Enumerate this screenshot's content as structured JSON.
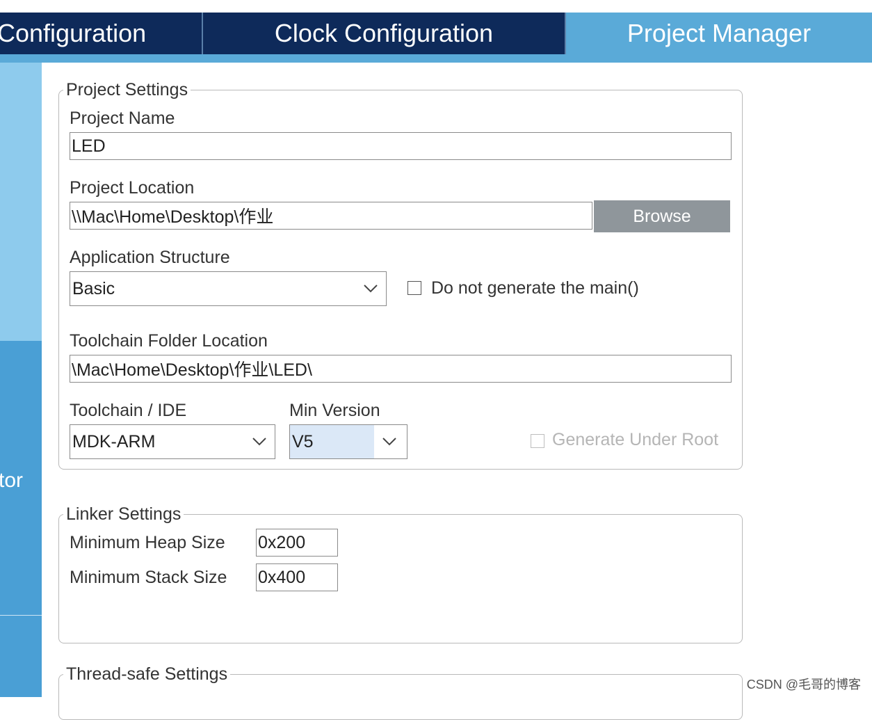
{
  "tabs": {
    "pinout": "Configuration",
    "clock": "Clock Configuration",
    "project_manager": "Project Manager"
  },
  "sidebar": {
    "partial_label": "tor"
  },
  "project_settings": {
    "legend": "Project Settings",
    "project_name_label": "Project Name",
    "project_name_value": "LED",
    "project_location_label": "Project Location",
    "project_location_value": "\\\\Mac\\Home\\Desktop\\作业",
    "browse_label": "Browse",
    "app_structure_label": "Application Structure",
    "app_structure_value": "Basic",
    "no_main_label": "Do not generate the main()",
    "toolchain_folder_label": "Toolchain Folder Location",
    "toolchain_folder_value": "\\Mac\\Home\\Desktop\\作业\\LED\\",
    "toolchain_ide_label": "Toolchain / IDE",
    "toolchain_ide_value": "MDK-ARM",
    "min_version_label": "Min Version",
    "min_version_value": "V5",
    "generate_under_root_label": "Generate Under Root"
  },
  "linker_settings": {
    "legend": "Linker Settings",
    "heap_label": "Minimum Heap Size",
    "heap_value": "0x200",
    "stack_label": "Minimum Stack Size",
    "stack_value": "0x400"
  },
  "thread_safe_settings": {
    "legend": "Thread-safe Settings"
  },
  "watermark": "CSDN @毛哥的博客",
  "colors": {
    "tab_dark": "#0e2a5a",
    "tab_active": "#5aaad8",
    "sidebar": "#4a9fd5",
    "browse_button": "#8f969b",
    "selected_highlight": "#dbe8f7"
  }
}
